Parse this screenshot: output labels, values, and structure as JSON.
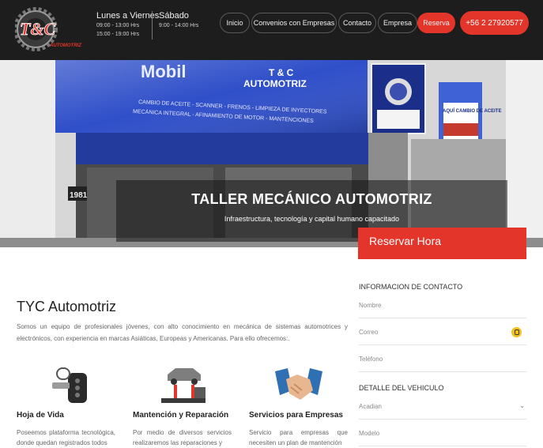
{
  "header": {
    "logo_text": "T&C",
    "logo_subtext": "AUTOMOTRIZ",
    "weekday_title": "Lunes a Viernes",
    "weekday_morning": "09:00 - 13:00 Hrs",
    "weekday_afternoon": "15:00 - 19:00 Hrs",
    "saturday_title": "Sábado",
    "saturday_hours": "9:00 - 14:00 Hrs",
    "nav": [
      "Inicio",
      "Convenios con Empresas",
      "Contacto",
      "Empresa",
      "Reserva"
    ],
    "phone": "+56 2 27920577"
  },
  "hero": {
    "title": "TALLER MECÁNICO AUTOMOTRIZ",
    "subtitle": "Infraestructura, tecnología y capital humano capacitado",
    "sign_brand": "Mobil",
    "sign_name_1": "T & C",
    "sign_name_2": "AUTOMOTRIZ",
    "sign_services_1": "CAMBIO DE ACEITE - SCANNER - FRENOS - LIMPIEZA DE INYECTORES",
    "sign_services_2": "MECÁNICA INTEGRAL - AFINAMIENTO DE MOTOR - MANTENCIONES",
    "side_sign_text": "AQUÍ CAMBIO DE ACEITE",
    "address_number": "1981"
  },
  "booking": {
    "title": "Reservar Hora",
    "contact_section": "INFORMACION DE CONTACTO",
    "fields": [
      "Nombre",
      "Correo",
      "Teléfono"
    ],
    "vehicle_section": "DETALLE DEL VEHICULO",
    "brand_selected": "Acadian",
    "model_placeholder": "Modelo"
  },
  "main": {
    "title": "TYC Automotriz",
    "intro": "Somos un equipo de profesionales jóvenes, con alto conocimiento en mecánica de sistemas automotrices y electrónicos, con experiencia en marcas Asiáticas, Europeas y Americanas. Para ello ofrecemos:.",
    "services": [
      {
        "icon": "car-key-icon",
        "title": "Hoja de Vida",
        "text": "Poseemos plataforma tecnológica, donde quedan registrados todos"
      },
      {
        "icon": "car-lift-icon",
        "title": "Mantención y Reparación",
        "text": "Por medio de diversos servicios realizaremos las reparaciones y"
      },
      {
        "icon": "handshake-icon",
        "title": "Servicios para Empresas",
        "text": "Servicio para empresas que necesiten un plan de mantención"
      }
    ]
  },
  "colors": {
    "accent": "#e3352a",
    "header_bg": "#1d1d1d",
    "sign_blue": "#2f4fc9"
  }
}
